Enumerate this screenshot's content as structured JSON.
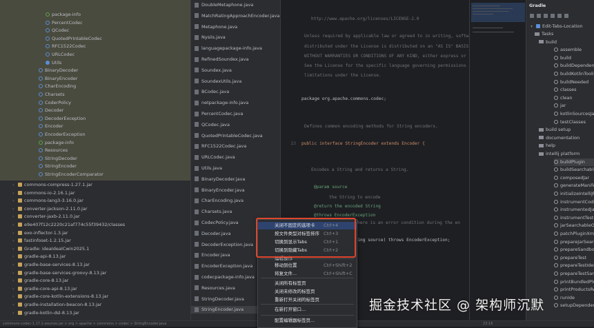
{
  "project_tree": {
    "highlighted_items": [
      "package-info",
      "PercentCodec",
      "QCodec",
      "QuotedPrintableCodec",
      "RFC1522Codec",
      "URLCodec",
      "Utils",
      "BinaryDecoder",
      "BinaryEncoder",
      "CharEncoding",
      "Charsets",
      "CoderPolicy",
      "Decoder",
      "DecoderException",
      "Encoder",
      "EncoderException",
      "package-info",
      "Resources",
      "StringDecoder",
      "StringEncoder",
      "StringEncoderComparator"
    ],
    "libraries": [
      "commons-compress-1.27.1.jar",
      "commons-io-2.16.1.jar",
      "commons-lang3-3.16.0.jar",
      "converter-jackson-2.11.0.jar",
      "converter-jaxb-2.11.0.jar",
      "e9e407f12c2220c21af774c55f39432/classes",
      "exo-inflector-1.3.jar",
      "fastinfoset-1.2.15.jar",
      "Gradle: ideaIdeaICwin2025.1",
      "gradle-api-8.13.jar",
      "gradle-base-services-8.13.jar",
      "gradle-base-services-groovy-8.13.jar",
      "gradle-core-8.13.jar",
      "gradle-core-api-8.13.jar",
      "gradle-core-kotlin-extensions-8.13.jar",
      "gradle-installation-beacon-8.13.jar",
      "gradle-kotlin-dsl-8.13.jar"
    ]
  },
  "file_list": {
    "items": [
      "DoubleMetaphone.java",
      "MatchRatingApproachEncoder.java",
      "Metaphone.java",
      "Nysiis.java",
      "languagepackage-info.java",
      "RefinedSoundex.java",
      "Soundex.java",
      "SoundexUtils.java",
      "BCodec.java",
      "netpackage-info.java",
      "PercentCodec.java",
      "QCodec.java",
      "QuotedPrintableCodec.java",
      "RFC1522Codec.java",
      "URLCodec.java",
      "Utils.java",
      "BinaryDecoder.java",
      "BinaryEncoder.java",
      "CharEncoding.java",
      "Charsets.java",
      "CodecPolicy.java",
      "Decoder.java",
      "DecoderException.java",
      "Encoder.java",
      "EncoderException.java",
      "codecpackage-info.java",
      "Resources.java",
      "StringDecoder.java",
      "StringEncoder.java"
    ],
    "selected": "StringEncoder.java"
  },
  "editor": {
    "current_line": "23",
    "lines": [
      {
        "n": "",
        "t": "http://www.apache.org/licenses/LICENSE-2.0",
        "c": "cm"
      },
      {
        "n": "",
        "t": "Unless required by applicable law or agreed to in writing, software",
        "c": "cm"
      },
      {
        "n": "",
        "t": "distributed under the License is distributed on an \"AS IS\" BASIS,",
        "c": "cm"
      },
      {
        "n": "",
        "t": "WITHOUT WARRANTIES OR CONDITIONS OF ANY KIND, either express or impl",
        "c": "cm"
      },
      {
        "n": "",
        "t": "See the License for the specific language governing permissions and",
        "c": "cm"
      },
      {
        "n": "",
        "t": "limitations under the License.",
        "c": "cm"
      },
      {
        "n": "",
        "t": "package org.apache.commons.codec;",
        "c": "id"
      },
      {
        "n": "",
        "t": "Defines common encoding methods for String encoders.",
        "c": "cm"
      },
      {
        "n": "23",
        "t": "public interface StringEncoder extends Encoder {",
        "c": "kw"
      },
      {
        "n": "",
        "t": "Encodes a String and returns a String.",
        "c": "cm"
      },
      {
        "n": "",
        "t": "@param source",
        "c": "tg"
      },
      {
        "n": "",
        "t": "the String to encode",
        "c": "cm"
      },
      {
        "n": "",
        "t": "@return the encoded String",
        "c": "tg"
      },
      {
        "n": "",
        "t": "@throws EncoderException",
        "c": "tg"
      },
      {
        "n": "",
        "t": "thrown if there is an error condition during the en",
        "c": "cm"
      },
      {
        "n": "",
        "t": "String encode(String source) throws EncoderException;",
        "c": "id"
      }
    ]
  },
  "gradle_panel": {
    "title": "Gradle",
    "project": "Edit-Tabs-Location",
    "items": [
      "Tasks",
      "build",
      "assemble",
      "build",
      "buildDependents",
      "buildKotlinToolin",
      "buildNeeded",
      "classes",
      "clean",
      "jar",
      "kotlinSourcesJar",
      "testClasses",
      "build setup",
      "documentation",
      "help",
      "intellij platform",
      "buildPlugin",
      "buildSearchableOp",
      "composedJar",
      "generateManifest",
      "initializeIntelliJPl",
      "instrumentCode",
      "instrumentedJar",
      "instrumentTestCod",
      "jarSearchableOptio",
      "patchPluginXml",
      "prepareJarSearch",
      "prepareSandbox",
      "prepareTest",
      "prepareTestIdeDev",
      "prepareTestSandbo",
      "printBundledPlugi",
      "printProductsRele",
      "runIde",
      "setupDependencies"
    ],
    "selected": "buildPlugin"
  },
  "context_menu": {
    "items": [
      {
        "label": "关闭不固定的选项卡",
        "shortcut": "Ctrl+4"
      },
      {
        "label": "按文件类型对标签排序",
        "shortcut": "Ctrl+3"
      },
      {
        "label": "切换到显示Tabs",
        "shortcut": "Ctrl+1"
      },
      {
        "label": "切换到隐藏Tabs",
        "shortcut": "Ctrl+2"
      },
      {
        "label": "编辑操作",
        "shortcut": ""
      },
      {
        "label": "移动到位置",
        "shortcut": "Ctrl+Shift+2"
      },
      {
        "label": "将复文件...",
        "shortcut": "Ctrl+Shift+C"
      },
      {
        "label": "关闭所有标签页",
        "shortcut": ""
      },
      {
        "label": "关闭未修改的标签页",
        "shortcut": ""
      },
      {
        "label": "重新打开关闭的标签页",
        "shortcut": ""
      },
      {
        "label": "在新打开窗口...",
        "shortcut": ""
      },
      {
        "label": "配置编辑器标签页...",
        "shortcut": ""
      }
    ]
  },
  "status_bar": {
    "text": "commons-codec-1.17.1-sources.jar  >  org  >  apache  >  commons  >  codec  >  StringEncoder.java",
    "position": "23:16"
  },
  "watermark": "掘金技术社区 @ 架构师沉默",
  "colors": {
    "menu_highlight": "#2e436e",
    "annotation_box": "#e0452b"
  }
}
